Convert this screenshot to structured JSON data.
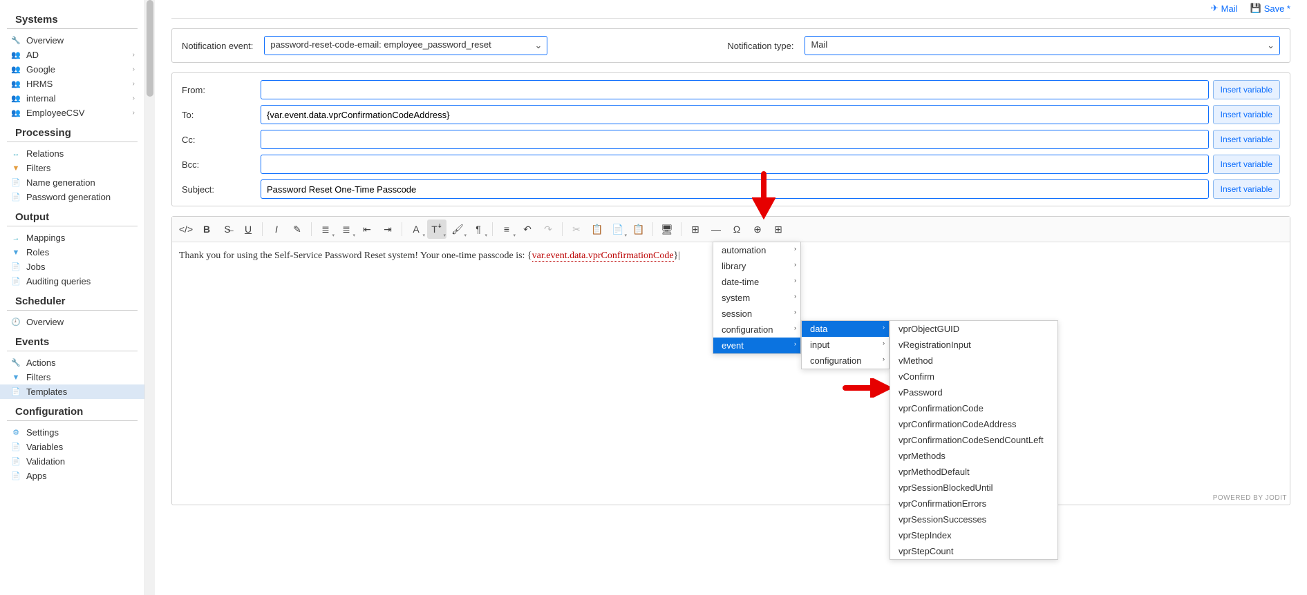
{
  "topbar": {
    "mail": "Mail",
    "save": "Save *"
  },
  "sidebar": {
    "groups": [
      {
        "title": "Systems",
        "items": [
          {
            "icon": "🔧",
            "cls": "ic-blue",
            "label": "Overview"
          },
          {
            "icon": "👥",
            "cls": "ic-grey",
            "label": "AD",
            "chev": true
          },
          {
            "icon": "👥",
            "cls": "ic-grey",
            "label": "Google",
            "chev": true
          },
          {
            "icon": "👥",
            "cls": "ic-grey",
            "label": "HRMS",
            "chev": true
          },
          {
            "icon": "👥",
            "cls": "ic-grey",
            "label": "internal",
            "chev": true
          },
          {
            "icon": "👥",
            "cls": "ic-grey",
            "label": "EmployeeCSV",
            "chev": true
          }
        ]
      },
      {
        "title": "Processing",
        "items": [
          {
            "icon": "↔",
            "cls": "ic-teal",
            "label": "Relations"
          },
          {
            "icon": "▼",
            "cls": "ic-orange",
            "label": "Filters"
          },
          {
            "icon": "📄",
            "cls": "ic-orange",
            "label": "Name generation"
          },
          {
            "icon": "📄",
            "cls": "ic-orange",
            "label": "Password generation"
          }
        ]
      },
      {
        "title": "Output",
        "items": [
          {
            "icon": "→",
            "cls": "ic-teal",
            "label": "Mappings"
          },
          {
            "icon": "▼",
            "cls": "ic-blue",
            "label": "Roles"
          },
          {
            "icon": "📄",
            "cls": "ic-green",
            "label": "Jobs"
          },
          {
            "icon": "📄",
            "cls": "ic-green",
            "label": "Auditing queries"
          }
        ]
      },
      {
        "title": "Scheduler",
        "items": [
          {
            "icon": "🕘",
            "cls": "ic-blue",
            "label": "Overview"
          }
        ]
      },
      {
        "title": "Events",
        "items": [
          {
            "icon": "🔧",
            "cls": "ic-blue",
            "label": "Actions"
          },
          {
            "icon": "▼",
            "cls": "ic-blue",
            "label": "Filters"
          },
          {
            "icon": "📄",
            "cls": "ic-orange",
            "label": "Templates",
            "active": true
          }
        ]
      },
      {
        "title": "Configuration",
        "items": [
          {
            "icon": "⚙",
            "cls": "ic-blue",
            "label": "Settings"
          },
          {
            "icon": "📄",
            "cls": "ic-green",
            "label": "Variables"
          },
          {
            "icon": "📄",
            "cls": "ic-green",
            "label": "Validation"
          },
          {
            "icon": "📄",
            "cls": "ic-green",
            "label": "Apps"
          }
        ]
      }
    ]
  },
  "form": {
    "event_label": "Notification event:",
    "event_value": "password-reset-code-email: employee_password_reset",
    "type_label": "Notification type:",
    "type_value": "Mail",
    "fields": [
      {
        "label": "From:",
        "value": ""
      },
      {
        "label": "To:",
        "value": "{var.event.data.vprConfirmationCodeAddress}"
      },
      {
        "label": "Cc:",
        "value": ""
      },
      {
        "label": "Bcc:",
        "value": ""
      },
      {
        "label": "Subject:",
        "value": "Password Reset One-Time Passcode"
      }
    ],
    "insert_btn": "Insert variable"
  },
  "editor": {
    "body_prefix": "Thank you for using the Self-Service Password Reset system! Your one-time passcode is:  {",
    "body_highlight": "var.event.data.vprConfirmationCode",
    "body_suffix": "}|"
  },
  "toolbar_icons": [
    {
      "g": "</>"
    },
    {
      "g": "B",
      "style": "font-weight:bold"
    },
    {
      "g": "S̶"
    },
    {
      "g": "U",
      "style": "text-decoration:underline"
    },
    {
      "sep": true
    },
    {
      "g": "I",
      "style": "font-style:italic"
    },
    {
      "g": "✎"
    },
    {
      "sep": true
    },
    {
      "g": "≣",
      "grp": true
    },
    {
      "g": "≣",
      "grp": true
    },
    {
      "g": "⇤"
    },
    {
      "g": "⇥"
    },
    {
      "sep": true
    },
    {
      "g": "A",
      "grp": true
    },
    {
      "g": "Tꜜ",
      "grp": true,
      "box": true
    },
    {
      "g": "🖌",
      "grp": true
    },
    {
      "g": "¶",
      "grp": true
    },
    {
      "sep": true
    },
    {
      "g": "≡",
      "grp": true
    },
    {
      "g": "↶"
    },
    {
      "g": "↷",
      "dis": true
    },
    {
      "sep": true
    },
    {
      "g": "✂",
      "dis": true
    },
    {
      "g": "📋",
      "dis": true
    },
    {
      "g": "📄",
      "grp": true
    },
    {
      "g": "📋"
    },
    {
      "sep": true
    },
    {
      "g": "🖥"
    },
    {
      "sep": true
    },
    {
      "g": "⊞"
    },
    {
      "g": "—"
    },
    {
      "g": "Ω"
    },
    {
      "g": "⊕",
      "name": "insert-variable"
    },
    {
      "g": "⊞"
    }
  ],
  "menus": {
    "level1": [
      {
        "label": "automation",
        "sub": true
      },
      {
        "label": "library",
        "sub": true
      },
      {
        "label": "date-time",
        "sub": true
      },
      {
        "label": "system",
        "sub": true
      },
      {
        "label": "session",
        "sub": true
      },
      {
        "label": "configuration",
        "sub": true
      },
      {
        "label": "event",
        "sub": true,
        "hl": true
      }
    ],
    "level2": [
      {
        "label": "data",
        "sub": true,
        "hl": true
      },
      {
        "label": "input",
        "sub": true
      },
      {
        "label": "configuration",
        "sub": true
      }
    ],
    "level3": [
      "vprObjectGUID",
      "vRegistrationInput",
      "vMethod",
      "vConfirm",
      "vPassword",
      "vprConfirmationCode",
      "vprConfirmationCodeAddress",
      "vprConfirmationCodeSendCountLeft",
      "vprMethods",
      "vprMethodDefault",
      "vprSessionBlockedUntil",
      "vprConfirmationErrors",
      "vprSessionSuccesses",
      "vprStepIndex",
      "vprStepCount"
    ]
  },
  "footer": "POWERED BY JODIT"
}
